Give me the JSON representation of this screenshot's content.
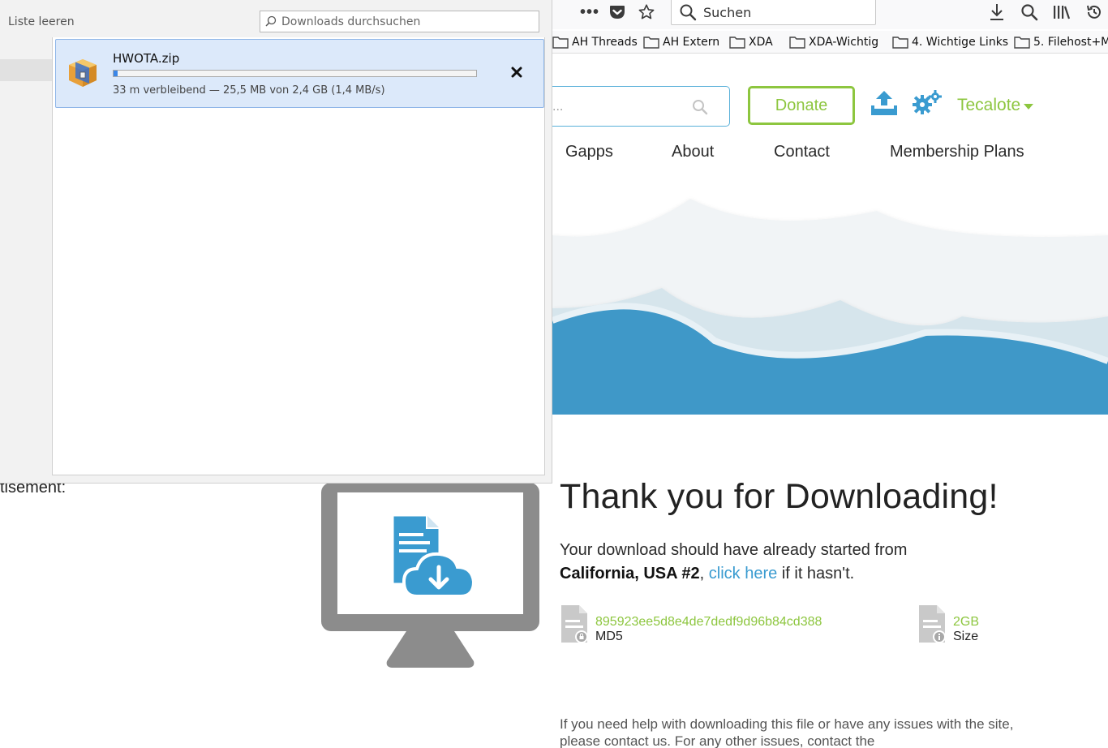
{
  "browser": {
    "search_placeholder": "Suchen",
    "bookmarks": [
      "AH Threads",
      "AH Extern",
      "XDA",
      "XDA-Wichtig",
      "4. Wichtige Links",
      "5. Filehost+M"
    ]
  },
  "downloads_panel": {
    "clear_list_label": "Liste leeren",
    "search_placeholder": "Downloads durchsuchen",
    "items": [
      {
        "filename": "HWOTA.zip",
        "status": "33 m verbleibend — 25,5 MB von 2,4 GB (1,4 MB/s)",
        "progress_percent": 1.06
      }
    ]
  },
  "site": {
    "donate_label": "Donate",
    "username": "Tecalote",
    "search_placeholder": "...",
    "nav": [
      "Gapps",
      "About",
      "Contact",
      "Membership Plans"
    ],
    "advert_label": "tisement:",
    "thank_you_title": "Thank you for Downloading!",
    "download_info_prefix": "Your download should have already started from",
    "mirror_location": "California, USA #2",
    "comma": ",",
    "click_here": "click here",
    "download_info_suffix": "if it hasn't.",
    "md5_value": "895923ee5d8e4de7dedf9d96b84cd388",
    "md5_label": "MD5",
    "size_value": "2GB",
    "size_label": "Size",
    "help_text": "If you need help with downloading this file or have any issues with the site, please contact us. For any other issues, contact the"
  },
  "colors": {
    "accent_green": "#8dc63f",
    "link_blue": "#3a9bd0",
    "wave_blue": "#3f98c8",
    "download_highlight": "#dce9fa"
  }
}
